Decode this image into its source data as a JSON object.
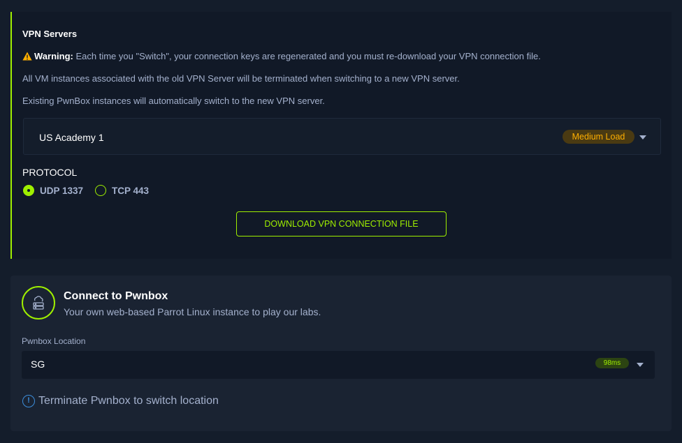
{
  "vpn": {
    "title": "VPN Servers",
    "warning_label": "Warning:",
    "warning_text": "Each time you \"Switch\", your connection keys are regenerated and you must re-download your VPN connection file.",
    "line2": "All VM instances associated with the old VPN Server will be terminated when switching to a new VPN server.",
    "line3": "Existing PwnBox instances will automatically switch to the new VPN server.",
    "server": {
      "name": "US Academy 1",
      "load": "Medium Load"
    },
    "protocol_label": "PROTOCOL",
    "protocols": [
      {
        "label": "UDP 1337",
        "selected": true
      },
      {
        "label": "TCP 443",
        "selected": false
      }
    ],
    "download_label": "DOWNLOAD VPN CONNECTION FILE"
  },
  "pwnbox": {
    "title": "Connect to Pwnbox",
    "subtitle": "Your own web-based Parrot Linux instance to play our labs.",
    "location_label": "Pwnbox Location",
    "location_value": "SG",
    "ping": "98ms",
    "terminate_text": "Terminate Pwnbox to switch location"
  },
  "colors": {
    "accent": "#9fef00",
    "warning": "#ffaf00",
    "info": "#3c8dda",
    "background": "#141d2b",
    "panel": "#111927"
  },
  "icons": [
    "warning-icon",
    "chevron-down-icon",
    "cloud-server-icon",
    "info-icon"
  ]
}
